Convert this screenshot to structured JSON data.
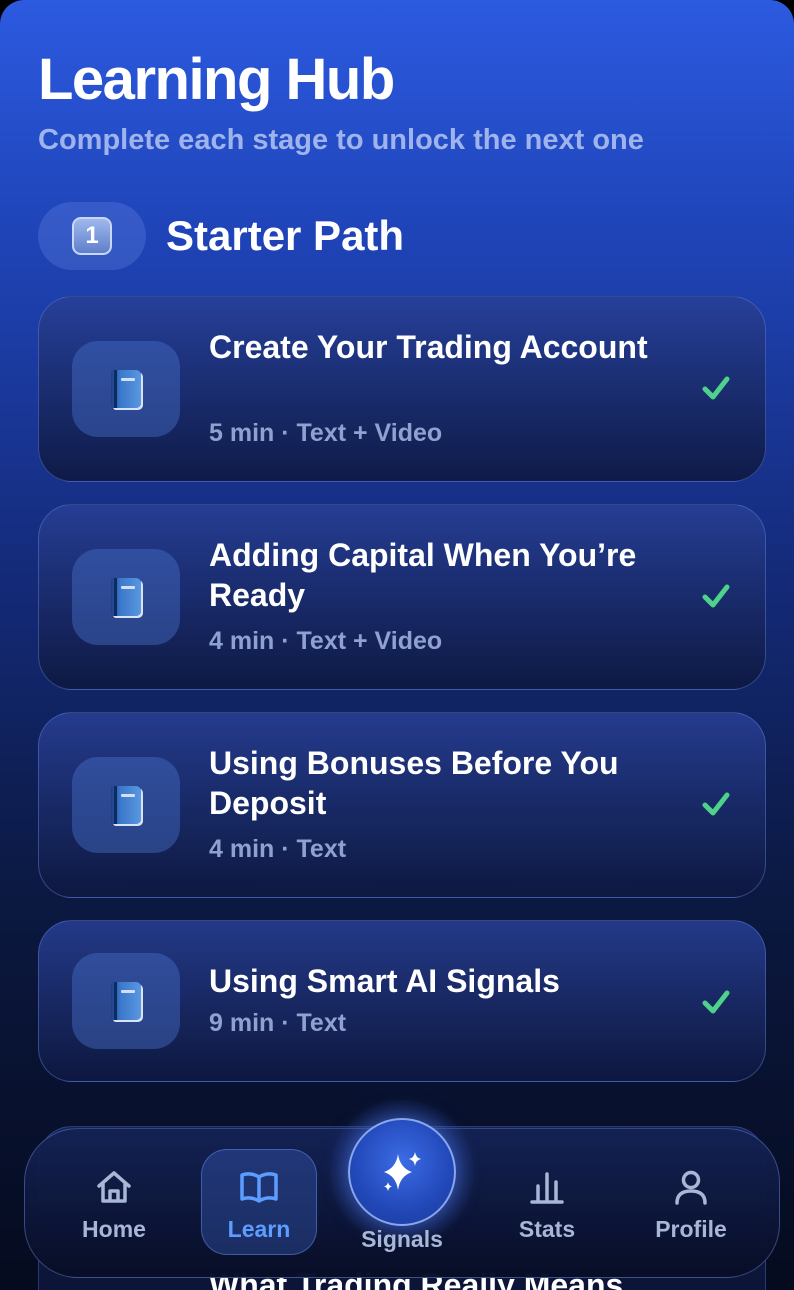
{
  "header": {
    "title": "Learning Hub",
    "subtitle": "Complete each stage to unlock the next one"
  },
  "section": {
    "stage_badge": "1",
    "title": "Starter Path"
  },
  "lessons": [
    {
      "title": "Create Your Trading Account",
      "meta": "5 min · Text + Video",
      "icon": "book-icon",
      "completed": true
    },
    {
      "title": "Adding Capital When You’re Ready",
      "meta": "4 min · Text + Video",
      "icon": "book-icon",
      "completed": true
    },
    {
      "title": "Using Bonuses Before You Deposit",
      "meta": "4 min · Text",
      "icon": "book-icon",
      "completed": true
    },
    {
      "title": "Using Smart AI Signals",
      "meta": "9 min · Text",
      "icon": "book-icon",
      "completed": true
    }
  ],
  "next_lesson_peek": {
    "title": "What Trading Really Means"
  },
  "nav": {
    "home": "Home",
    "learn": "Learn",
    "signals": "Signals",
    "stats": "Stats",
    "profile": "Profile",
    "active": "learn"
  },
  "colors": {
    "accent": "#5d9dff",
    "check": "#4ed18a",
    "muted_text": "#8fa2cf"
  }
}
